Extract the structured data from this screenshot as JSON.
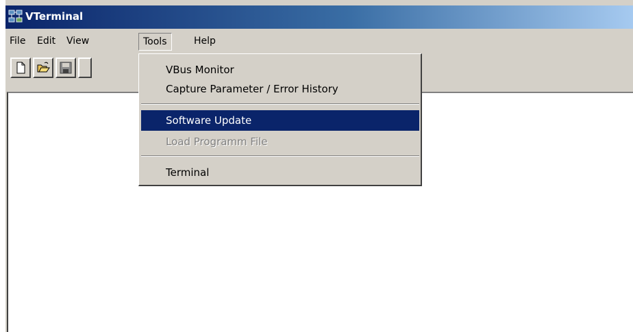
{
  "window": {
    "title": "VTerminal"
  },
  "menubar": {
    "items": [
      "File",
      "Edit",
      "View",
      "Tools",
      "Help"
    ],
    "open_menu": "Tools"
  },
  "toolbar": {
    "buttons": [
      "new-document-icon",
      "open-folder-icon",
      "save-disk-icon"
    ]
  },
  "tools_menu": {
    "items": [
      {
        "label": "VBus Monitor",
        "state": "normal"
      },
      {
        "label": "Capture Parameter / Error History",
        "state": "normal"
      },
      {
        "label": "Software Update",
        "state": "selected"
      },
      {
        "label": "Load Programm File",
        "state": "disabled"
      },
      {
        "label": "Terminal",
        "state": "normal"
      }
    ]
  },
  "colors": {
    "title_bar_start": "#0a246a",
    "title_bar_end": "#a6caf0",
    "highlight": "#0a246a",
    "face": "#d4d0c8"
  }
}
